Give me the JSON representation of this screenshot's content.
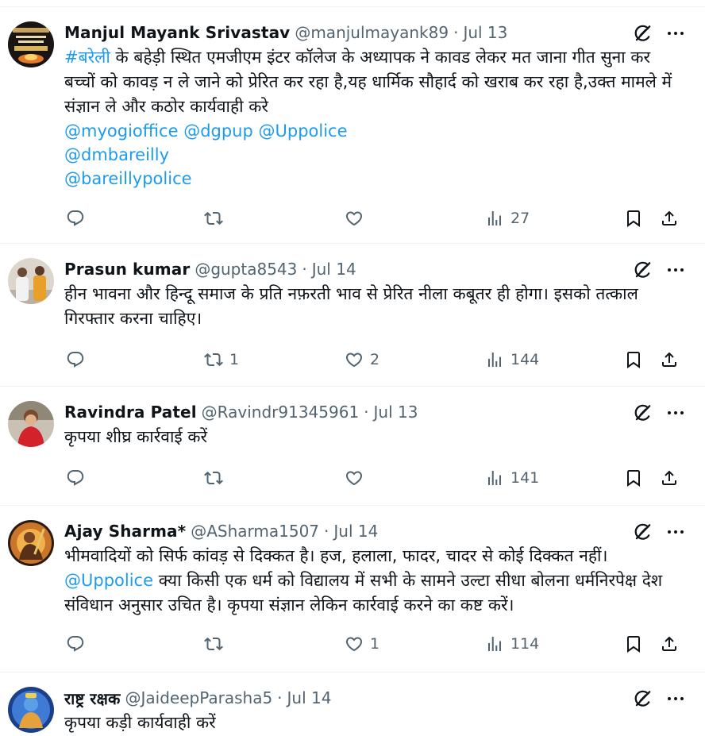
{
  "tweets": [
    {
      "name": "Manjul Mayank Srivastav",
      "handle": "@manjulmayank89",
      "date": "Jul 13",
      "hashtag": "#बरेली",
      "text": " के बहेड़ी स्थित एमजीएम इंटर कॉलेज के  अध्यापक ने कावड लेकर मत जाना गीत सुना कर बच्चों को कावड़ न ले जाने को प्रेरित कर रहा है,यह धार्मिक सौहार्द को खराब कर रहा है,उक्त मामले में संज्ञान ले और कठोर कार्यवाही करे",
      "mentions": [
        "@myogioffice @dgpup @Uppolice",
        "@dmbareilly",
        "@bareillypolice"
      ],
      "replies": "",
      "retweets": "",
      "likes": "",
      "views": "27"
    },
    {
      "name": "Prasun kumar",
      "handle": "@gupta8543",
      "date": "Jul 14",
      "text": "हीन भावना और हिन्दू समाज के प्रति नफ़रती भाव से प्रेरित नीला कबूतर ही होगा। इसको तत्काल गिरफ्तार करना चाहिए।",
      "replies": "",
      "retweets": "1",
      "likes": "2",
      "views": "144"
    },
    {
      "name": "Ravindra Patel",
      "handle": "@Ravindr91345961",
      "date": "Jul 13",
      "text": "कृपया शीघ्र कार्रवाई करें",
      "replies": "",
      "retweets": "",
      "likes": "",
      "views": "141"
    },
    {
      "name": "Ajay Sharma*",
      "handle": "@ASharma1507",
      "date": "Jul 14",
      "text_line1": "भीमवादियों को सिर्फ कांवड़ से दिक्कत है। हज, हलाला, फादर, चादर से कोई दिक्कत नहीं।",
      "mention": "@Uppolice",
      "text_rest": " क्या किसी एक धर्म को विद्यालय में सभी के सामने उल्टा सीधा बोलना धर्मनिरपेक्ष देश संविधान अनुसार उचित है। कृपया संज्ञान लेकिन कार्रवाई करने का कष्ट करें।",
      "replies": "",
      "retweets": "",
      "likes": "1",
      "views": "114"
    },
    {
      "name": "राष्ट्र रक्षक",
      "handle": "@JaideepParasha5",
      "date": "Jul 14",
      "text": "कृपया कड़ी कार्यवाही करें"
    }
  ],
  "colors": {
    "text": "#0f1419",
    "secondary": "#536471",
    "link": "#1d9bf0",
    "divider": "#eff3f4"
  },
  "icons": [
    "reply-icon",
    "retweet-icon",
    "like-icon",
    "views-icon",
    "bookmark-icon",
    "share-icon",
    "grok-icon",
    "more-icon"
  ]
}
